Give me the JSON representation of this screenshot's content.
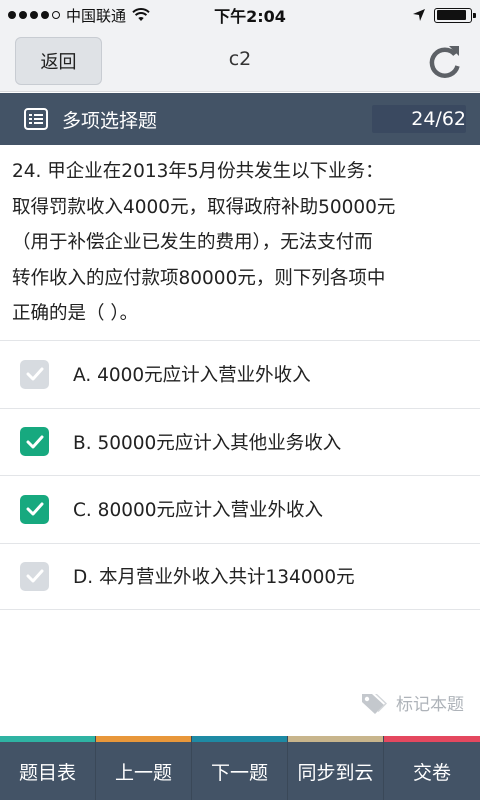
{
  "status_bar": {
    "carrier": "中国联通",
    "time": "下午2:04",
    "signal_bars": 4,
    "signal_max": 5,
    "battery_level": 0.9
  },
  "nav": {
    "back_label": "返回",
    "title": "c2",
    "refresh_icon": "refresh-icon"
  },
  "section": {
    "title": "多项选择题",
    "progress": "24/62",
    "icon": "list-icon"
  },
  "question": {
    "lines": [
      "24. 甲企业在2013年5月份共发生以下业务：",
      "取得罚款收入4000元，取得政府补助50000元",
      "（用于补偿企业已发生的费用），无法支付而",
      "转作收入的应付款项80000元，则下列各项中",
      "正确的是（ ）。"
    ]
  },
  "options": [
    {
      "text": "A. 4000元应计入营业外收入",
      "checked": false
    },
    {
      "text": "B. 50000元应计入其他业务收入",
      "checked": true
    },
    {
      "text": "C. 80000元应计入营业外收入",
      "checked": true
    },
    {
      "text": "D. 本月营业外收入共计134000元",
      "checked": false
    }
  ],
  "mark": {
    "label": "标记本题",
    "icon": "tag-icon"
  },
  "bottom_tabs": [
    {
      "label": "题目表",
      "stripe_color": "#2fb3a3"
    },
    {
      "label": "上一题",
      "stripe_color": "#e8973a"
    },
    {
      "label": "下一题",
      "stripe_color": "#1e8aa4"
    },
    {
      "label": "同步到云",
      "stripe_color": "#c8b58c"
    },
    {
      "label": "交卷",
      "stripe_color": "#e4485f"
    }
  ],
  "colors": {
    "header_bg": "#435366",
    "checked": "#17a97f",
    "unchecked": "#d7dbe0"
  }
}
